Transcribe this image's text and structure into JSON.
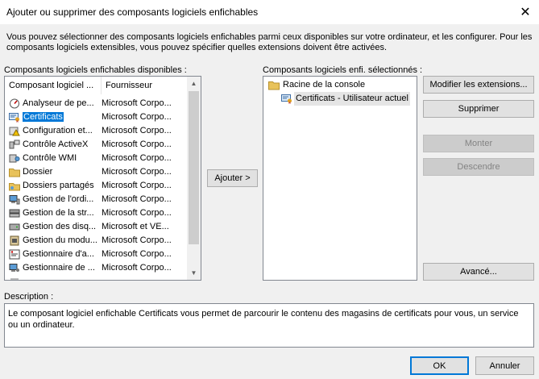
{
  "window": {
    "title": "Ajouter ou supprimer des composants logiciels enfichables",
    "close_glyph": "✕"
  },
  "intro_text": "Vous pouvez sélectionner des composants logiciels enfichables parmi ceux disponibles sur votre ordinateur, et les configurer. Pour les composants logiciels extensibles, vous pouvez spécifier quelles extensions doivent être activées.",
  "available": {
    "label": "Composants logiciels enfichables disponibles :",
    "columns": [
      "Composant logiciel ...",
      "Fournisseur"
    ],
    "items": [
      {
        "name": "Analyseur de pe...",
        "vendor": "Microsoft Corpo...",
        "icon": "performance-analyzer-icon"
      },
      {
        "name": "Certificats",
        "vendor": "Microsoft Corpo...",
        "icon": "certificates-icon",
        "selected": true
      },
      {
        "name": "Configuration et...",
        "vendor": "Microsoft Corpo...",
        "icon": "security-config-icon"
      },
      {
        "name": "Contrôle ActiveX",
        "vendor": "Microsoft Corpo...",
        "icon": "activex-icon"
      },
      {
        "name": "Contrôle WMI",
        "vendor": "Microsoft Corpo...",
        "icon": "wmi-icon"
      },
      {
        "name": "Dossier",
        "vendor": "Microsoft Corpo...",
        "icon": "folder-icon"
      },
      {
        "name": "Dossiers partagés",
        "vendor": "Microsoft Corpo...",
        "icon": "shared-folders-icon"
      },
      {
        "name": "Gestion de l'ordi...",
        "vendor": "Microsoft Corpo...",
        "icon": "computer-management-icon"
      },
      {
        "name": "Gestion de la str...",
        "vendor": "Microsoft Corpo...",
        "icon": "storage-management-icon"
      },
      {
        "name": "Gestion des disq...",
        "vendor": "Microsoft et VE...",
        "icon": "disk-management-icon"
      },
      {
        "name": "Gestion du modu...",
        "vendor": "Microsoft Corpo...",
        "icon": "tpm-management-icon"
      },
      {
        "name": "Gestionnaire d'a...",
        "vendor": "Microsoft Corpo...",
        "icon": "authorization-manager-icon"
      },
      {
        "name": "Gestionnaire de ...",
        "vendor": "Microsoft Corpo...",
        "icon": "device-manager-icon"
      },
      {
        "name": "",
        "vendor": "",
        "icon": "partial-row-icon"
      }
    ]
  },
  "add_button": "Ajouter >",
  "selected": {
    "label": "Composants logiciels enfi. sélectionnés :",
    "tree": [
      {
        "label": "Racine de la console",
        "icon": "folder-icon",
        "level": 0
      },
      {
        "label": "Certificats - Utilisateur actuel",
        "icon": "certificates-icon",
        "level": 1,
        "selected": true
      }
    ]
  },
  "side_buttons": {
    "modify_extensions": "Modifier les extensions...",
    "remove": "Supprimer",
    "move_up": "Monter",
    "move_down": "Descendre",
    "advanced": "Avancé..."
  },
  "description": {
    "label": "Description :",
    "text": "Le composant logiciel enfichable Certificats vous permet de parcourir le contenu des magasins de certificats pour vous, un service ou un ordinateur."
  },
  "footer": {
    "ok": "OK",
    "cancel": "Annuler"
  },
  "colors": {
    "accent": "#0078d7",
    "dialog_bg": "#f0f0f0",
    "folder": "#e8c25a"
  }
}
